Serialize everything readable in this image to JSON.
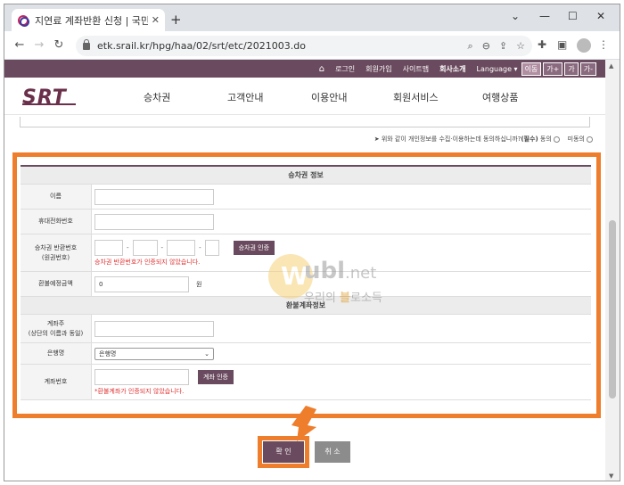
{
  "browser": {
    "tab_title": "지연료 계좌반환 신청 | 국민철도",
    "tab_close": "✕",
    "new_tab": "+",
    "url": "etk.srail.kr/hpg/haa/02/srt/etc/2021003.do",
    "win_min": "⌄",
    "win_minimize": "—",
    "win_max": "☐",
    "win_close": "✕"
  },
  "topnav": {
    "home": "⌂",
    "login": "로그인",
    "join": "회원가입",
    "sitemap": "사이트맵",
    "company": "회사소개",
    "language": "Language ▾",
    "lang_btn": "이동",
    "font_up": "가+",
    "font_normal": "가",
    "font_down": "가-"
  },
  "logo": "SRT",
  "mainnav": [
    "승차권",
    "고객안내",
    "이용안내",
    "회원서비스",
    "여행상품"
  ],
  "consent": {
    "text": "위와 같이 개인정보를 수집·이용하는데 동의하십니까?",
    "required": "(필수)",
    "agree": "동의",
    "disagree": "미동의"
  },
  "form": {
    "sec1": "승차권 정보",
    "name_label": "이름",
    "phone_label": "휴대전화번호",
    "ticket_label": "승차권 반환번호\n(원권번호)",
    "ticket_btn": "승차권 인증",
    "ticket_err": "승차권 반환번호가 인증되지 않았습니다.",
    "refund_label": "환불예정금액",
    "refund_value": "0",
    "refund_unit": "원",
    "sec2": "환불계좌정보",
    "holder_label": "계좌주\n(상단의 이름과 동일)",
    "bank_label": "은행명",
    "bank_value": "은행명",
    "account_label": "계좌번호",
    "account_btn": "계좌 인증",
    "account_err": "*환불계좌가 인증되지 않았습니다."
  },
  "watermark": {
    "w": "W",
    "brand": "ubl",
    "dot": ".net",
    "tag1": "우리의 ",
    "tag2": "블",
    "tag3": "로소득"
  },
  "buttons": {
    "ok": "확 인",
    "cancel": "취 소"
  },
  "colors": {
    "brand": "#6a4a5e",
    "highlight": "#ee7d2c",
    "error": "#e03030"
  }
}
